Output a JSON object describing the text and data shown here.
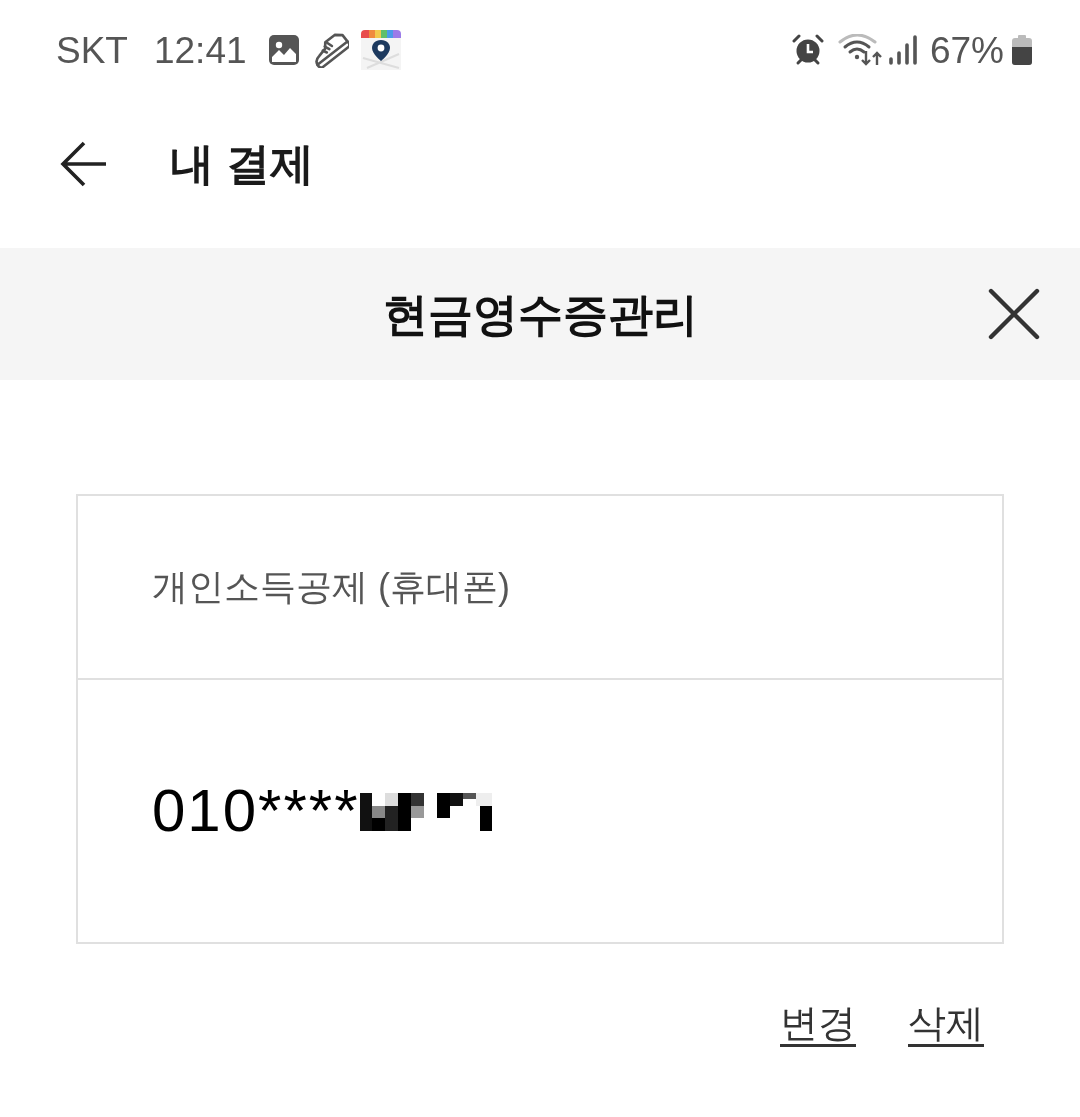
{
  "status_bar": {
    "carrier": "SKT",
    "time": "12:41",
    "battery": "67%"
  },
  "header": {
    "title": "내 결제"
  },
  "dialog": {
    "title": "현금영수증관리",
    "card": {
      "label": "개인소득공제 (휴대폰)",
      "number": "010****"
    },
    "actions": [
      {
        "label": "변경"
      },
      {
        "label": "삭제"
      }
    ]
  }
}
